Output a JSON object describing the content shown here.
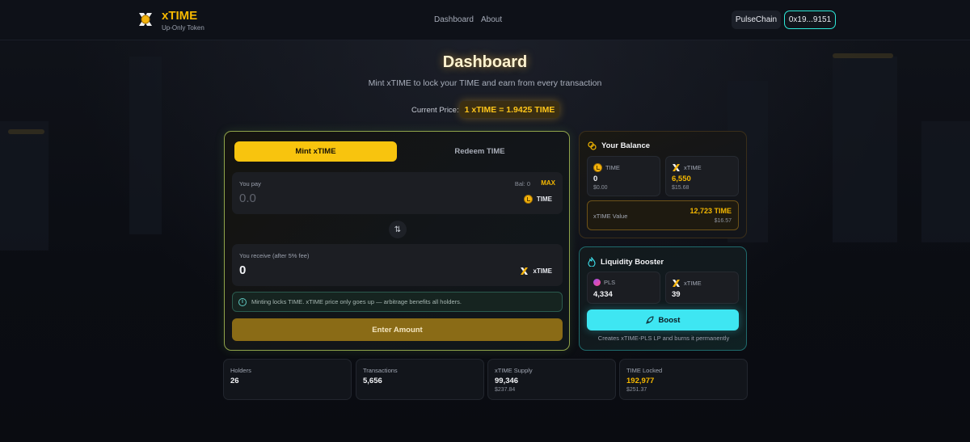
{
  "header": {
    "brand_name": "xTIME",
    "brand_sub": "Up-Only Token",
    "nav": [
      "Dashboard",
      "About"
    ],
    "chain": "PulseChain",
    "wallet": "0x19...9151"
  },
  "hero": {
    "title": "Dashboard",
    "subtitle": "Mint xTIME to lock your TIME and earn from every transaction",
    "price_label": "Current Price:",
    "price_value": "1 xTIME = 1.9425 TIME"
  },
  "swap": {
    "tab_mint": "Mint xTIME",
    "tab_redeem": "Redeem TIME",
    "pay": {
      "label": "You pay",
      "balance": "Bal: 0",
      "max": "MAX",
      "amount": "0.0",
      "token": "TIME"
    },
    "swap_icon": "⇅",
    "receive": {
      "label": "You receive (after 5% fee)",
      "amount": "0",
      "token": "xTIME"
    },
    "info": "Minting locks TIME. xTIME price only goes up — arbitrage benefits all holders.",
    "action": "Enter Amount"
  },
  "balance": {
    "title": "Your Balance",
    "time": {
      "label": "TIME",
      "value": "0",
      "usd": "$0.00"
    },
    "xtime": {
      "label": "xTIME",
      "value": "6,550",
      "usd": "$15.68"
    },
    "xtime_value": {
      "label": "xTIME Value",
      "value": "12,723 TIME",
      "usd": "$16.57"
    }
  },
  "booster": {
    "title": "Liquidity Booster",
    "pls": {
      "label": "PLS",
      "value": "4,334"
    },
    "xtime": {
      "label": "xTIME",
      "value": "39"
    },
    "button": "Boost",
    "note": "Creates xTIME-PLS LP and burns it permanently"
  },
  "stats": [
    {
      "label": "Holders",
      "value": "26",
      "sub": ""
    },
    {
      "label": "Transactions",
      "value": "5,656",
      "sub": ""
    },
    {
      "label": "xTIME Supply",
      "value": "99,346",
      "sub": "$237.84"
    },
    {
      "label": "TIME Locked",
      "value": "192,977",
      "sub": "$251.37"
    }
  ],
  "colors": {
    "accent_gold": "#f5b800",
    "accent_cyan": "#3ee6f2",
    "background": "#0b0e14"
  }
}
